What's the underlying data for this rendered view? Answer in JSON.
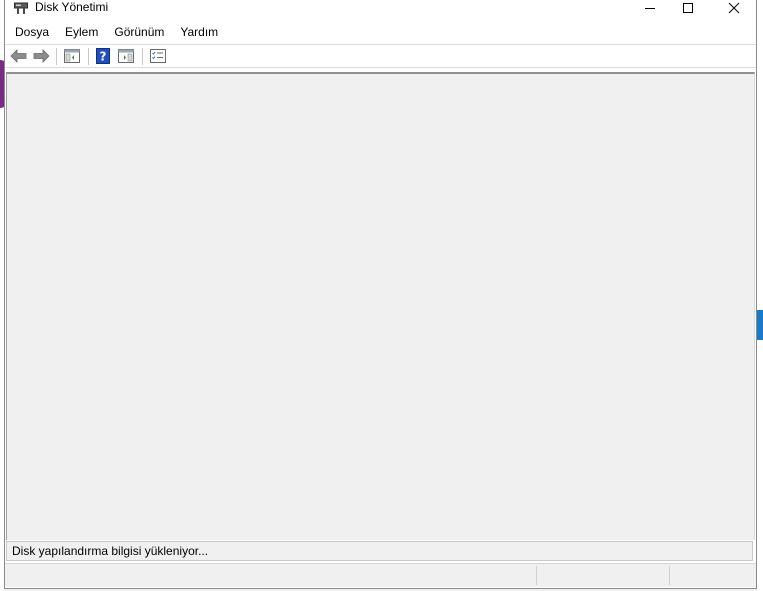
{
  "window": {
    "title": "Disk Yönetimi"
  },
  "menu": {
    "items": [
      {
        "label": "Dosya"
      },
      {
        "label": "Eylem"
      },
      {
        "label": "Görünüm"
      },
      {
        "label": "Yardım"
      }
    ]
  },
  "toolbar": {
    "buttons": [
      {
        "icon": "back-arrow-icon"
      },
      {
        "icon": "forward-arrow-icon"
      },
      {
        "icon": "console-tree-icon"
      },
      {
        "icon": "help-icon"
      },
      {
        "icon": "action-pane-icon"
      },
      {
        "icon": "properties-icon"
      }
    ]
  },
  "status": {
    "loading_text": "Disk yapılandırma bilgisi yükleniyor..."
  },
  "colors": {
    "accent_purple": "#7a2a86",
    "accent_blue": "#1979ca",
    "help_blue": "#1f4fbf"
  }
}
